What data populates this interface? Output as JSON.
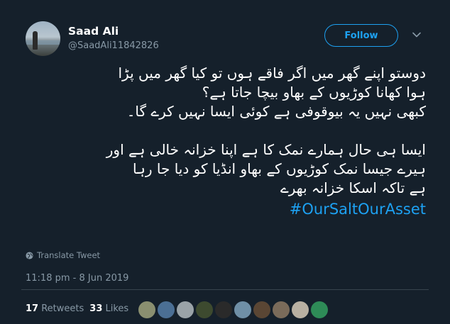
{
  "author": {
    "name": "Saad Ali",
    "handle": "@SaadAli11842826",
    "follow_label": "Follow"
  },
  "tweet": {
    "lines": [
      "دوستو اپنے گھر میں اگر فاقے ہوں تو کیا گھر میں پڑا",
      "ہوا کھانا کوڑیوں کے بھاو بیچا جاتا ہے؟",
      "کبھی نہیں یہ بیوقوفی ہے کوئی ایسا نہیں کرے گا۔",
      "",
      "ایسا ہی حال ہمارے نمک کا ہے اپنا خزانہ خالی ہے اور",
      "ہیرے جیسا نمک کوڑیوں کے بھاو انڈیا کو دیا جا رہا",
      "ہے تاکہ اسکا خزانہ بھرے"
    ],
    "hashtag": "#OurSaltOurAsset",
    "translate_label": "Translate Tweet",
    "timestamp": "11:18 pm - 8 Jun 2019"
  },
  "stats": {
    "retweets_count": "17",
    "retweets_label": "Retweets",
    "likes_count": "33",
    "likes_label": "Likes"
  },
  "likers_colors": [
    "#8a8f70",
    "#4b6f94",
    "#9aa3a8",
    "#3d4a2f",
    "#2a2a2a",
    "#6f8fa6",
    "#5a4634",
    "#7a6b5a",
    "#b8b0a2",
    "#2e8b57"
  ],
  "colors": {
    "background": "#15202b",
    "accent": "#1da1f2",
    "muted": "#8899a6"
  }
}
